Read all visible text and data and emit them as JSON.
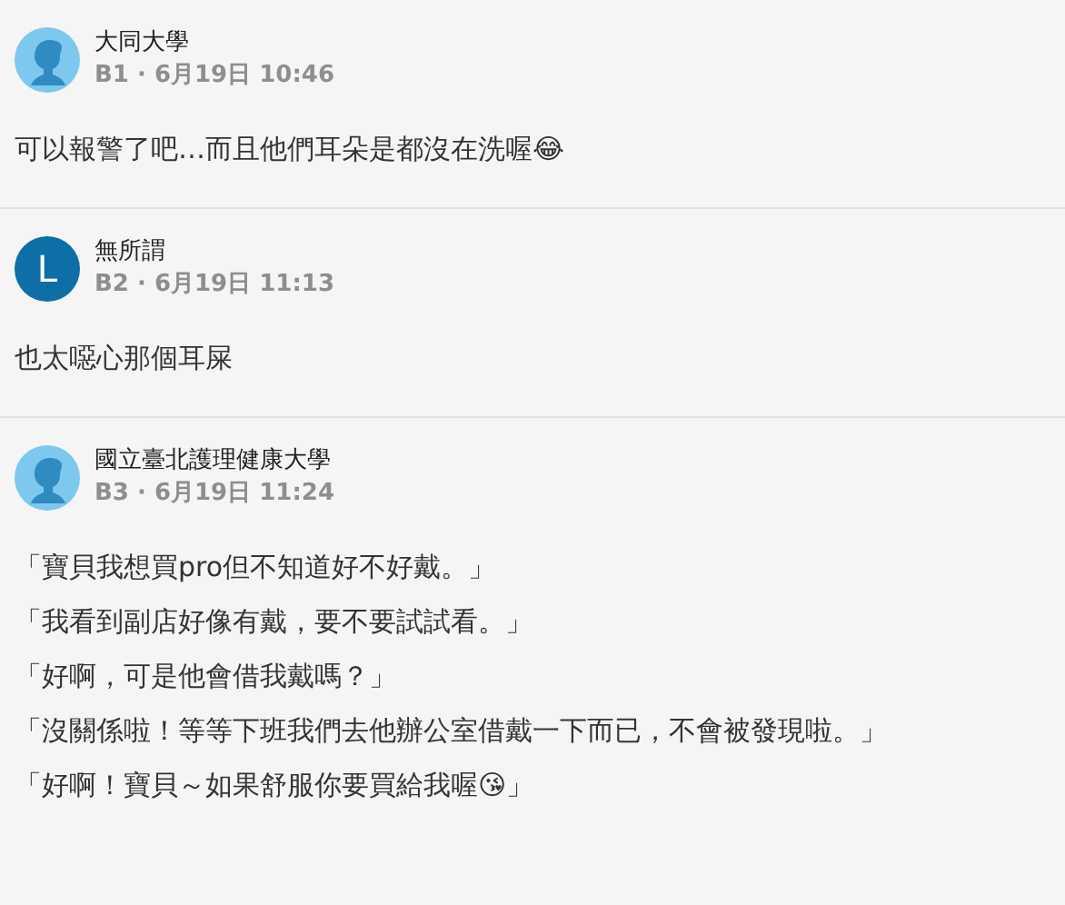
{
  "comments": [
    {
      "avatar": {
        "kind": "silhouette"
      },
      "author": "大同大學",
      "meta": "B1 · 6月19日 10:46",
      "lines": [
        "可以報警了吧…而且他們耳朵是都沒在洗喔😂"
      ]
    },
    {
      "avatar": {
        "kind": "letter",
        "letter": "L"
      },
      "author": "無所謂",
      "meta": "B2 · 6月19日 11:13",
      "lines": [
        "也太噁心那個耳屎"
      ]
    },
    {
      "avatar": {
        "kind": "silhouette"
      },
      "author": "國立臺北護理健康大學",
      "meta": "B3 · 6月19日 11:24",
      "lines": [
        "「寶貝我想買pro但不知道好不好戴。」",
        "「我看到副店好像有戴，要不要試試看。」",
        "「好啊，可是他會借我戴嗎？」",
        "「沒關係啦！等等下班我們去他辦公室借戴一下而已，不會被發現啦。」",
        "「好啊！寶貝～如果舒服你要買給我喔😘」"
      ]
    }
  ]
}
